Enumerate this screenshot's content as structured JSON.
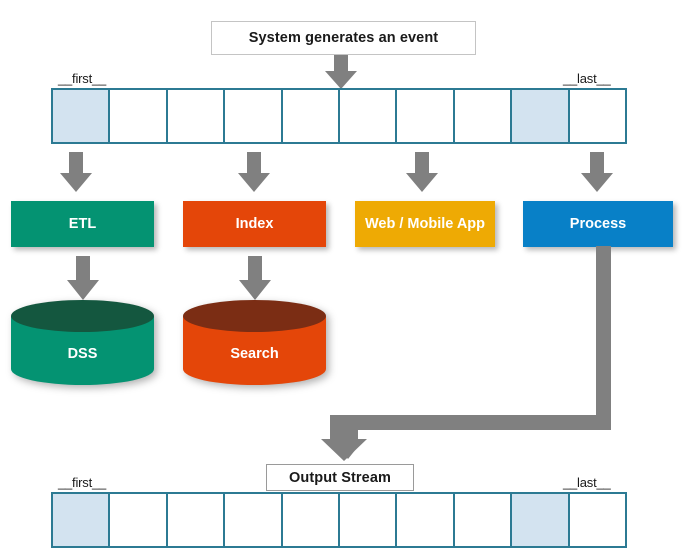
{
  "diagram": {
    "title_top": "System generates an event",
    "title_bottom": "Output Stream",
    "colors": {
      "buffer_border": "#2c7a93",
      "buffer_cell_filled": "#d3e3f0",
      "buffer_cell_empty": "#ffffff",
      "arrow_gray": "#808080",
      "etl_green": "#049372",
      "index_orange": "#e44609",
      "web_amber": "#eeaa04",
      "process_blue": "#0880c7",
      "dss_cylinder": "#049372",
      "dss_cylinder_top": "#14573f",
      "search_cylinder": "#e44609",
      "search_cylinder_top": "#7b2d14",
      "box_border": "#c4c4c4",
      "text_dark": "#1a1a1a",
      "text_light": "#ffffff"
    },
    "input_stream": {
      "name": "input-event-buffer",
      "first_label": "__first__",
      "last_label": "__last__",
      "cell_count": 10,
      "filled_indices": [
        0,
        8
      ],
      "cells": [
        {
          "index": 0,
          "filled": true
        },
        {
          "index": 1,
          "filled": false
        },
        {
          "index": 2,
          "filled": false
        },
        {
          "index": 3,
          "filled": false
        },
        {
          "index": 4,
          "filled": false
        },
        {
          "index": 5,
          "filled": false
        },
        {
          "index": 6,
          "filled": false
        },
        {
          "index": 7,
          "filled": false
        },
        {
          "index": 8,
          "filled": true
        },
        {
          "index": 9,
          "filled": false
        }
      ]
    },
    "output_stream": {
      "name": "output-event-buffer",
      "first_label": "__first__",
      "last_label": "__last__",
      "cell_count": 10,
      "filled_indices": [
        0,
        8
      ],
      "cells": [
        {
          "index": 0,
          "filled": true
        },
        {
          "index": 1,
          "filled": false
        },
        {
          "index": 2,
          "filled": false
        },
        {
          "index": 3,
          "filled": false
        },
        {
          "index": 4,
          "filled": false
        },
        {
          "index": 5,
          "filled": false
        },
        {
          "index": 6,
          "filled": false
        },
        {
          "index": 7,
          "filled": false
        },
        {
          "index": 8,
          "filled": true
        },
        {
          "index": 9,
          "filled": false
        }
      ]
    },
    "consumers": [
      {
        "id": "etl",
        "label": "ETL",
        "color": "#049372"
      },
      {
        "id": "index",
        "label": "Index",
        "color": "#e44609"
      },
      {
        "id": "web",
        "label": "Web / Mobile App",
        "color": "#eeaa04"
      },
      {
        "id": "process",
        "label": "Process",
        "color": "#0880c7"
      }
    ],
    "datastores": [
      {
        "id": "dss",
        "label": "DSS",
        "color": "#049372",
        "top_color": "#14573f"
      },
      {
        "id": "search",
        "label": "Search",
        "color": "#e44609",
        "top_color": "#7b2d14"
      }
    ],
    "connectors": [
      {
        "from": "system-event",
        "to": "input-event-buffer",
        "style": "down-arrow"
      },
      {
        "from": "input-event-buffer",
        "to": "etl",
        "style": "down-arrow"
      },
      {
        "from": "input-event-buffer",
        "to": "index",
        "style": "down-arrow"
      },
      {
        "from": "input-event-buffer",
        "to": "web",
        "style": "down-arrow"
      },
      {
        "from": "input-event-buffer",
        "to": "process",
        "style": "down-arrow"
      },
      {
        "from": "etl",
        "to": "dss",
        "style": "down-arrow"
      },
      {
        "from": "index",
        "to": "search",
        "style": "down-arrow"
      },
      {
        "from": "process",
        "to": "output-event-buffer",
        "style": "elbow-arrow"
      }
    ]
  }
}
